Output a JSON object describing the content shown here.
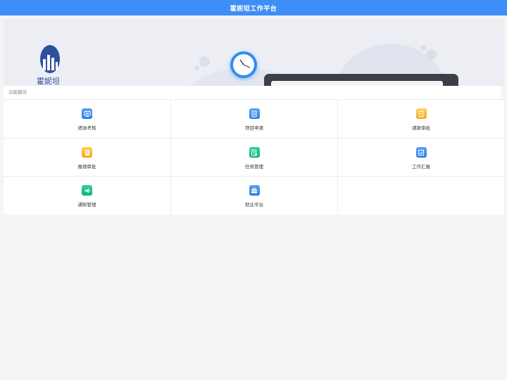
{
  "header": {
    "title": "霍妮坦工作平台"
  },
  "banner": {
    "logo_text": "霍妮坦"
  },
  "section": {
    "title": "功能模块"
  },
  "modules": [
    {
      "label": "绩效考核",
      "icon": "monitor-icon",
      "color": "blue"
    },
    {
      "label": "项目申请",
      "icon": "document-icon",
      "color": "blue"
    },
    {
      "label": "请款审批",
      "icon": "invoice-icon",
      "color": "yellow"
    },
    {
      "label": "报销审批",
      "icon": "receipt-icon",
      "color": "yellow"
    },
    {
      "label": "任务管理",
      "icon": "task-list-icon",
      "color": "green"
    },
    {
      "label": "工作汇报",
      "icon": "report-check-icon",
      "color": "blue"
    },
    {
      "label": "通知管理",
      "icon": "megaphone-icon",
      "color": "green"
    },
    {
      "label": "就业平台",
      "icon": "briefcase-icon",
      "color": "blue"
    }
  ],
  "colors": {
    "topbar": "#3e8ef7",
    "icon_blue": "#3d8cf0",
    "icon_yellow": "#f7b733",
    "icon_green": "#1cc48a"
  }
}
